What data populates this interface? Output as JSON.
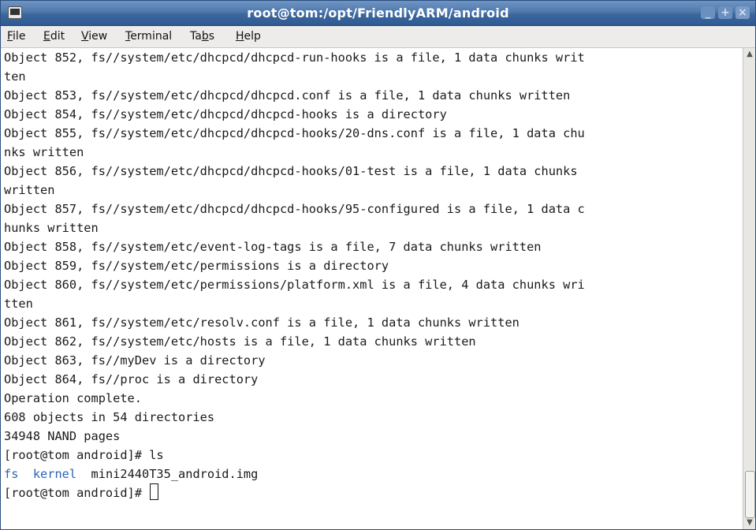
{
  "window": {
    "title": "root@tom:/opt/FriendlyARM/android",
    "minimize_glyph": "_",
    "maximize_glyph": "+",
    "close_glyph": "×"
  },
  "menu": [
    {
      "pre": "",
      "ul": "F",
      "post": "ile"
    },
    {
      "pre": "",
      "ul": "E",
      "post": "dit"
    },
    {
      "pre": "",
      "ul": "V",
      "post": "iew"
    },
    {
      "pre": "",
      "ul": "T",
      "post": "erminal"
    },
    {
      "pre": "Ta",
      "ul": "b",
      "post": "s"
    },
    {
      "pre": "",
      "ul": "H",
      "post": "elp"
    }
  ],
  "terminal": {
    "lines": [
      "Object 852, fs//system/etc/dhcpcd/dhcpcd-run-hooks is a file, 1 data chunks writ",
      "ten",
      "Object 853, fs//system/etc/dhcpcd/dhcpcd.conf is a file, 1 data chunks written",
      "Object 854, fs//system/etc/dhcpcd/dhcpcd-hooks is a directory",
      "Object 855, fs//system/etc/dhcpcd/dhcpcd-hooks/20-dns.conf is a file, 1 data chu",
      "nks written",
      "Object 856, fs//system/etc/dhcpcd/dhcpcd-hooks/01-test is a file, 1 data chunks",
      "written",
      "Object 857, fs//system/etc/dhcpcd/dhcpcd-hooks/95-configured is a file, 1 data c",
      "hunks written",
      "Object 858, fs//system/etc/event-log-tags is a file, 7 data chunks written",
      "Object 859, fs//system/etc/permissions is a directory",
      "Object 860, fs//system/etc/permissions/platform.xml is a file, 4 data chunks wri",
      "tten",
      "Object 861, fs//system/etc/resolv.conf is a file, 1 data chunks written",
      "Object 862, fs//system/etc/hosts is a file, 1 data chunks written",
      "Object 863, fs//myDev is a directory",
      "Object 864, fs//proc is a directory",
      "Operation complete.",
      "608 objects in 54 directories",
      "34948 NAND pages",
      "[root@tom android]# ls"
    ],
    "ls_output": {
      "dir1": "fs",
      "dir2": "kernel",
      "file": "mini2440T35_android.img"
    },
    "prompt": "[root@tom android]# "
  },
  "colors": {
    "titlebar": "#3d689e",
    "directory": "#2a64b8",
    "text": "#1a1a1a"
  }
}
